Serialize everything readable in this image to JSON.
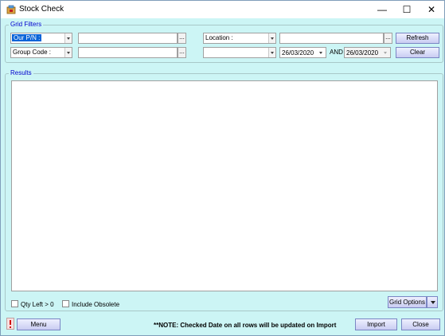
{
  "window": {
    "title": "Stock Check",
    "minimize_glyph": "—",
    "maximize_glyph": "☐",
    "close_glyph": "✕"
  },
  "grid_filters": {
    "legend": "Grid Filters",
    "field1_combo": "Our P/N :",
    "field2_combo": "Group Code :",
    "location_combo": "Location :",
    "ellipsis": "...",
    "refresh_label": "Refresh",
    "clear_label": "Clear",
    "date_from": "26/03/2020",
    "and_label": "AND",
    "date_to": "26/03/2020"
  },
  "results": {
    "legend": "Results",
    "qty_left_label": "Qty Left > 0",
    "include_obsolete_label": "Include Obsolete",
    "grid_options_label": "Grid Options"
  },
  "footer": {
    "menu_label": "Menu",
    "note": "**NOTE: Checked Date on all rows will be updated on Import",
    "import_label": "Import",
    "close_label": "Close"
  },
  "colors": {
    "background": "#ccf5f5",
    "accent_blue": "#0a64d8",
    "legend_text": "#0000cc"
  }
}
